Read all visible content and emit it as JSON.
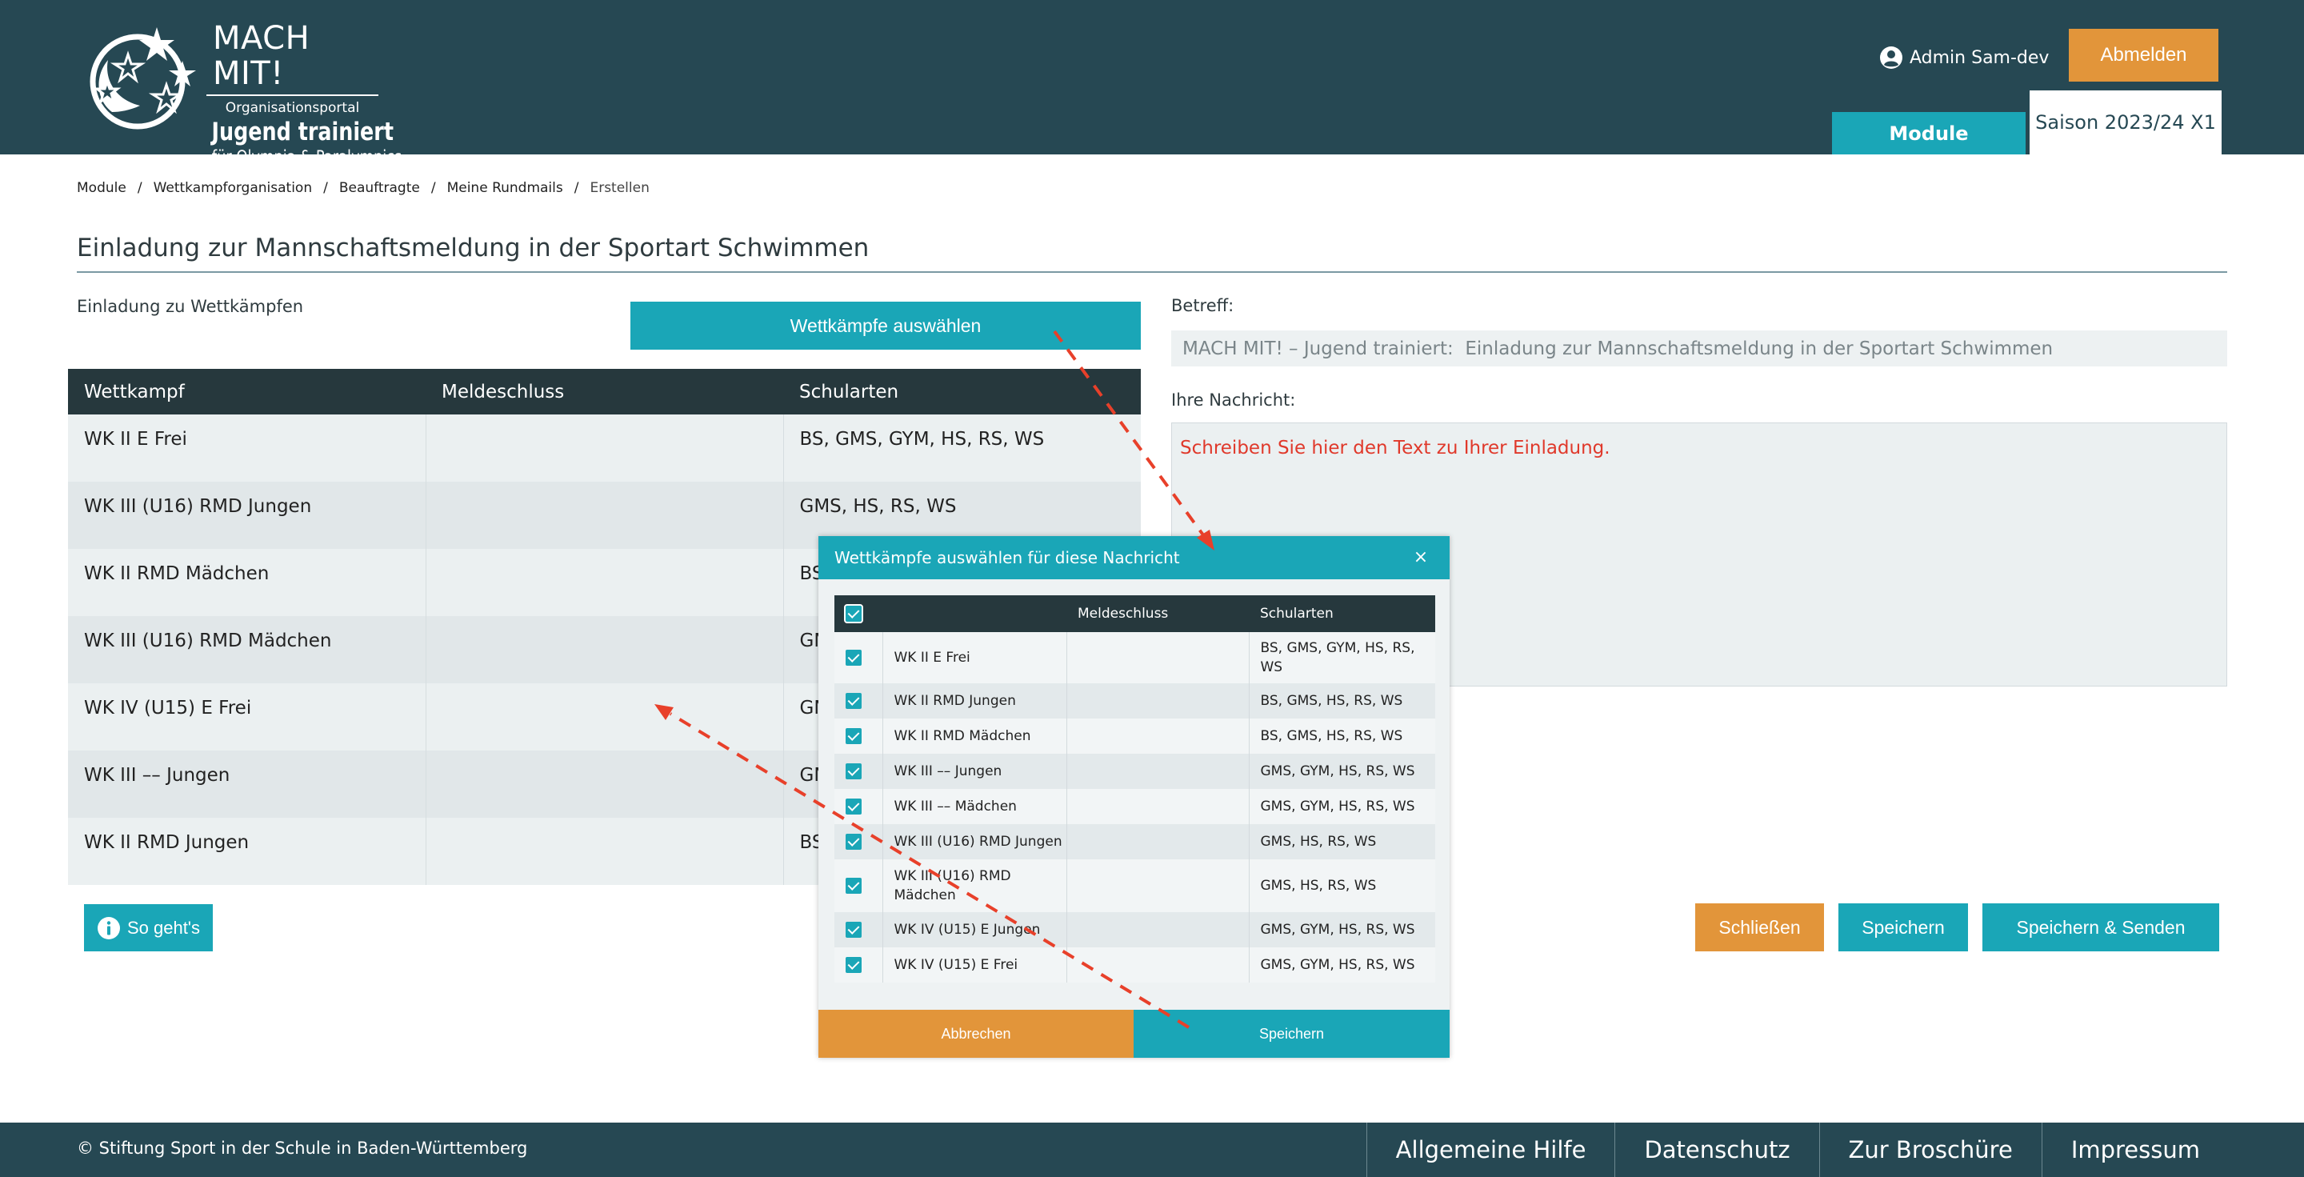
{
  "header": {
    "logo": {
      "title": "MACH MIT!",
      "subtitle": "Organisationsportal",
      "name": "Jugend trainiert",
      "tagline": "für Olympia & Paralympics"
    },
    "user_label": "Admin Sam-dev",
    "logout_label": "Abmelden",
    "module_tab": "Module",
    "season_tab": "Saison 2023/24 X1"
  },
  "breadcrumb": [
    "Module",
    "Wettkampforganisation",
    "Beauftragte",
    "Meine Rundmails",
    "Erstellen"
  ],
  "page_title": "Einladung zur Mannschaftsmeldung in der Sportart Schwimmen",
  "left": {
    "section_label": "Einladung zu Wettkämpfen",
    "select_button": "Wettkämpfe auswählen",
    "columns": [
      "Wettkampf",
      "Meldeschluss",
      "Schularten"
    ],
    "rows": [
      {
        "wettkampf": "WK II E Frei",
        "meldeschluss": "",
        "schularten": "BS, GMS, GYM, HS, RS, WS"
      },
      {
        "wettkampf": "WK III (U16) RMD Jungen",
        "meldeschluss": "",
        "schularten": "GMS, HS, RS, WS"
      },
      {
        "wettkampf": "WK II RMD Mädchen",
        "meldeschluss": "",
        "schularten": "BS"
      },
      {
        "wettkampf": "WK III (U16) RMD Mädchen",
        "meldeschluss": "",
        "schularten": "GN"
      },
      {
        "wettkampf": "WK IV (U15) E Frei",
        "meldeschluss": "",
        "schularten": "GN"
      },
      {
        "wettkampf": "WK III –– Jungen",
        "meldeschluss": "",
        "schularten": "GN"
      },
      {
        "wettkampf": "WK II RMD Jungen",
        "meldeschluss": "",
        "schularten": "BS"
      }
    ],
    "howto_button": "So geht's"
  },
  "right": {
    "subject_label": "Betreff:",
    "subject_value": "MACH MIT! – Jugend trainiert:  Einladung zur Mannschaftsmeldung in der Sportart Schwimmen",
    "message_label": "Ihre Nachricht:",
    "message_placeholder": "Schreiben Sie hier den Text zu Ihrer Einladung.",
    "close_button": "Schließen",
    "save_button": "Speichern",
    "save_send_button": "Speichern & Senden"
  },
  "modal": {
    "title": "Wettkämpfe auswählen für diese Nachricht",
    "close_symbol": "×",
    "columns": [
      "",
      "",
      "Meldeschluss",
      "Schularten"
    ],
    "rows": [
      {
        "checked": true,
        "wettkampf": "WK II E Frei",
        "meldeschluss": "",
        "schularten": "BS, GMS, GYM, HS, RS, WS"
      },
      {
        "checked": true,
        "wettkampf": "WK II RMD Jungen",
        "meldeschluss": "",
        "schularten": "BS, GMS, HS, RS, WS"
      },
      {
        "checked": true,
        "wettkampf": "WK II RMD Mädchen",
        "meldeschluss": "",
        "schularten": "BS, GMS, HS, RS, WS"
      },
      {
        "checked": true,
        "wettkampf": "WK III –– Jungen",
        "meldeschluss": "",
        "schularten": "GMS, GYM, HS, RS, WS"
      },
      {
        "checked": true,
        "wettkampf": "WK III –– Mädchen",
        "meldeschluss": "",
        "schularten": "GMS, GYM, HS, RS, WS"
      },
      {
        "checked": true,
        "wettkampf": "WK III (U16) RMD Jungen",
        "meldeschluss": "",
        "schularten": "GMS, HS, RS, WS"
      },
      {
        "checked": true,
        "wettkampf": "WK III (U16) RMD Mädchen",
        "meldeschluss": "",
        "schularten": "GMS, HS, RS, WS"
      },
      {
        "checked": true,
        "wettkampf": "WK IV (U15) E Jungen",
        "meldeschluss": "",
        "schularten": "GMS, GYM, HS, RS, WS"
      },
      {
        "checked": true,
        "wettkampf": "WK IV (U15) E Frei",
        "meldeschluss": "",
        "schularten": "GMS, GYM, HS, RS, WS"
      }
    ],
    "cancel_button": "Abbrechen",
    "save_button": "Speichern"
  },
  "footer": {
    "copyright": "© Stiftung Sport in der Schule in Baden-Württemberg",
    "links": [
      "Allgemeine Hilfe",
      "Datenschutz",
      "Zur Broschüre",
      "Impressum"
    ]
  },
  "colors": {
    "header": "#264853",
    "accent": "#1aa6b7",
    "orange": "#e2953a",
    "table_head": "#26383d",
    "annotation": "#e8402a"
  }
}
